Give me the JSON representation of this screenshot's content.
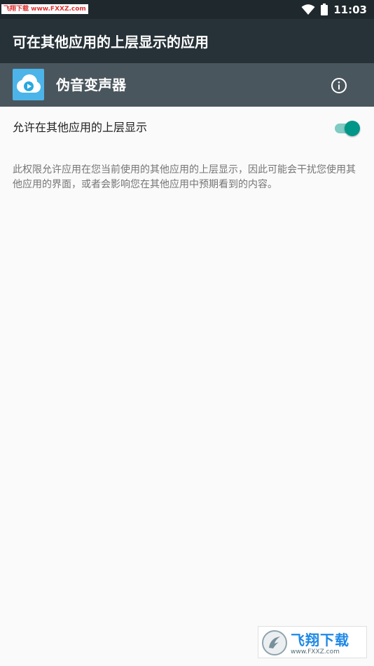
{
  "status_bar": {
    "watermark": "飞翔下载 www.FXXZ.com",
    "time": "11:03",
    "icons": [
      "wifi-icon",
      "battery-icon"
    ]
  },
  "toolbar": {
    "title": "可在其他应用的上层显示的应用"
  },
  "app": {
    "name": "伪音变声器",
    "icon": "app-icon",
    "icon_color": "#4cb4e8",
    "info_icon": "info-icon"
  },
  "permission": {
    "label": "允许在其他应用的上层显示",
    "enabled": true,
    "accent_color": "#009688"
  },
  "description": "此权限允许应用在您当前使用的其他应用的上层显示，因此可能会干扰您使用其他应用的界面，或者会影响您在其他应用中预期看到的内容。",
  "watermark_bottom": {
    "name": "飞翔下载",
    "url": "www.FXXZ.com"
  }
}
